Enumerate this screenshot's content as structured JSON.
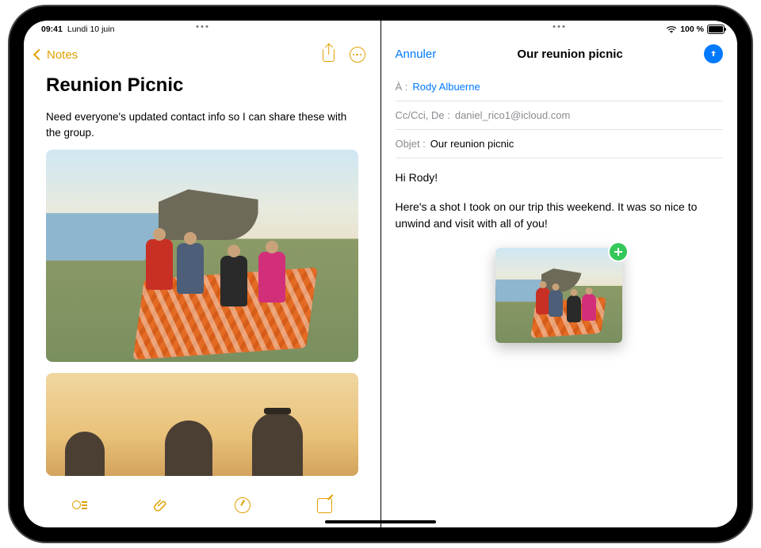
{
  "status": {
    "time": "09:41",
    "date": "Lundi 10 juin",
    "battery_text": "100 %"
  },
  "notes_app": {
    "back_label": "Notes",
    "title": "Reunion Picnic",
    "body_text": "Need everyone's updated contact info so I can share these with the group."
  },
  "mail_app": {
    "cancel_label": "Annuler",
    "title": "Our reunion picnic",
    "to_label": "À :",
    "to_value": "Rody Albuerne",
    "cc_label": "Cc/Cci, De :",
    "from_value": "daniel_rico1@icloud.com",
    "subject_label": "Objet :",
    "subject_value": "Our reunion picnic",
    "greeting": "Hi Rody!",
    "body_line": "Here's a shot I took on our trip this weekend. It was so nice to unwind and visit with all of you!"
  },
  "colors": {
    "notes_accent": "#e0a000",
    "ios_blue": "#007aff",
    "add_green": "#34c759"
  }
}
